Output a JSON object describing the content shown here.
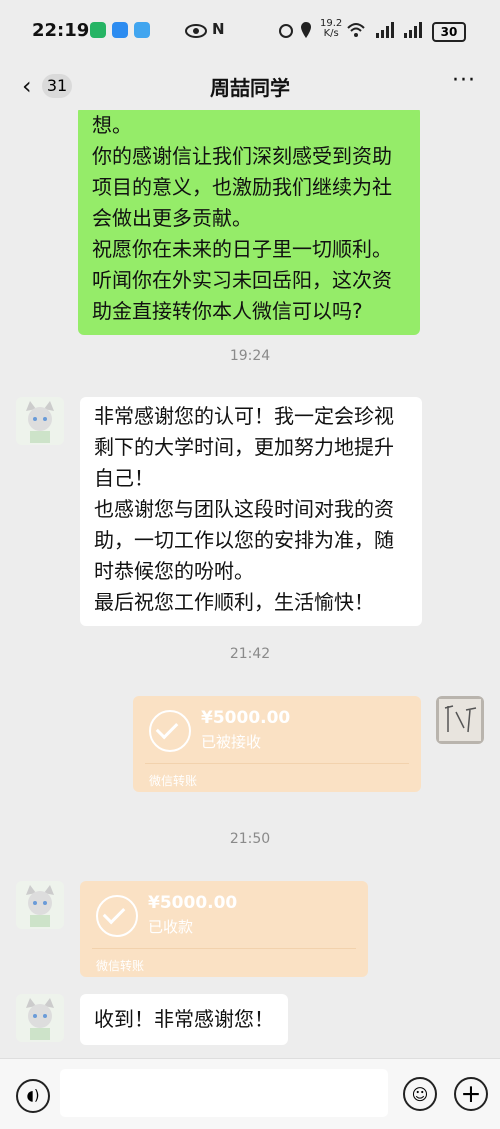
{
  "status_bar": {
    "time": "22:19",
    "net_speed": "19.2",
    "net_unit": "K/s",
    "battery": "30",
    "icons": [
      "eye-icon",
      "nfc-icon",
      "alarm-icon",
      "location-icon",
      "wifi-icon",
      "signal-icon"
    ]
  },
  "header": {
    "back_icon": "back-icon",
    "unread_count": "31",
    "title": "周喆同学",
    "more": "···"
  },
  "messages": {
    "m1": "想。\n你的感谢信让我们深刻感受到资助\n项目的意义，也激励我们继续为社\n会做出更多贡献。\n祝愿你在未来的日子里一切顺利。\n听闻你在外实习未回岳阳，这次资\n助金直接转你本人微信可以吗?",
    "t1": "19:24",
    "m2": "非常感谢您的认可！我一定会珍视\n剩下的大学时间，更加努力地提升\n自己！\n也感谢您与团队这段时间对我的资\n助，一切工作以您的安排为准，随\n时恭候您的吩咐。\n最后祝您工作顺利，生活愉快！",
    "t2": "21:42",
    "transfer1": {
      "amount": "¥5000.00",
      "status": "已被接收",
      "label": "微信转账"
    },
    "t3": "21:50",
    "transfer2": {
      "amount": "¥5000.00",
      "status": "已收款",
      "label": "微信转账"
    },
    "m3": "收到！非常感谢您！"
  },
  "colors": {
    "sent": "#95ec69",
    "received": "#ffffff",
    "transfer": "#fae1c4",
    "background": "#ededed"
  },
  "input_bar": {
    "icons": [
      "voice-icon",
      "emoji-icon",
      "plus-icon"
    ]
  }
}
